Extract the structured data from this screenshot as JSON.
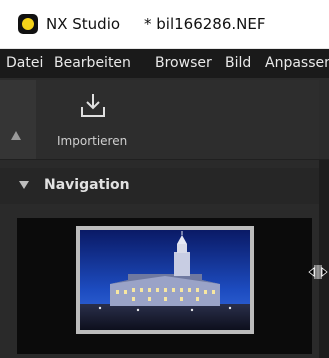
{
  "window": {
    "app_name": "NX Studio",
    "document_title": "* bil166286.NEF"
  },
  "menu": {
    "items": [
      "Datei",
      "Bearbeiten",
      "Browser",
      "Bild",
      "Anpassen"
    ]
  },
  "toolbar": {
    "import_label": "Importieren",
    "import_icon": "import-icon",
    "collapse_icon": "collapse-up-icon"
  },
  "navigation_panel": {
    "title": "Navigation",
    "expanded": true,
    "preview": "building-at-night-thumbnail"
  },
  "cursor": {
    "type": "column-resize-cursor"
  },
  "colors": {
    "titlebar_bg": "#ffffff",
    "menubar_bg": "#1a1a1a",
    "panel_bg": "#2a2a2a",
    "logo_yellow": "#f4d21a"
  }
}
